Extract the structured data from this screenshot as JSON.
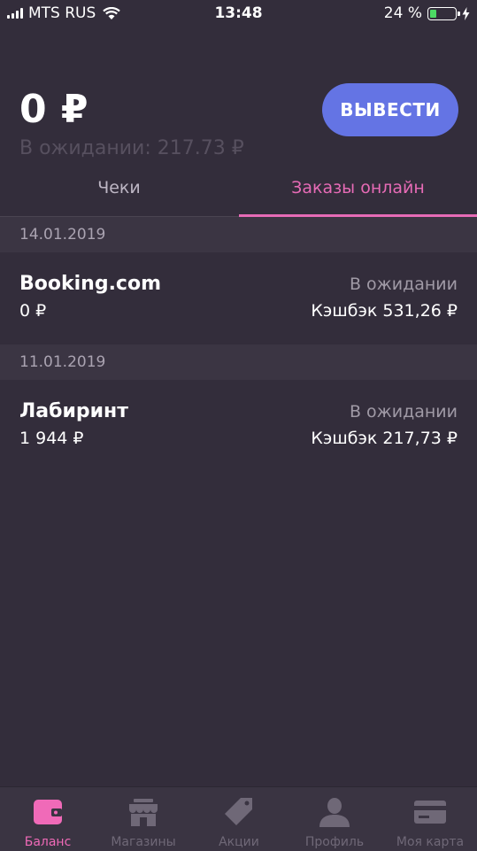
{
  "status_bar": {
    "carrier": "MTS RUS",
    "time": "13:48",
    "battery_percent": "24 %",
    "battery_level": 0.24,
    "icons": [
      "signal-icon",
      "wifi-icon",
      "battery-icon",
      "charging-icon"
    ]
  },
  "header": {
    "balance": "0 ₽",
    "pending": "В ожидании: 217.73 ₽",
    "withdraw_label": "ВЫВЕСТИ"
  },
  "tabs": [
    {
      "label": "Чеки",
      "active": false
    },
    {
      "label": "Заказы онлайн",
      "active": true
    }
  ],
  "groups": [
    {
      "date": "14.01.2019",
      "orders": [
        {
          "name": "Booking.com",
          "amount": "0 ₽",
          "status": "В ожидании",
          "cashback": "Кэшбэк 531,26 ₽"
        }
      ]
    },
    {
      "date": "11.01.2019",
      "orders": [
        {
          "name": "Лабиринт",
          "amount": "1 944 ₽",
          "status": "В ожидании",
          "cashback": "Кэшбэк 217,73 ₽"
        }
      ]
    }
  ],
  "bottom_nav": [
    {
      "label": "Баланс",
      "icon": "wallet-icon",
      "active": true
    },
    {
      "label": "Магазины",
      "icon": "store-icon",
      "active": false
    },
    {
      "label": "Акции",
      "icon": "tag-icon",
      "active": false
    },
    {
      "label": "Профиль",
      "icon": "profile-icon",
      "active": false
    },
    {
      "label": "Моя карта",
      "icon": "card-icon",
      "active": false
    }
  ],
  "colors": {
    "background": "#332d3b",
    "accent_pink": "#e76bb6",
    "button_blue": "#6474e4",
    "battery_green": "#4cd964"
  }
}
